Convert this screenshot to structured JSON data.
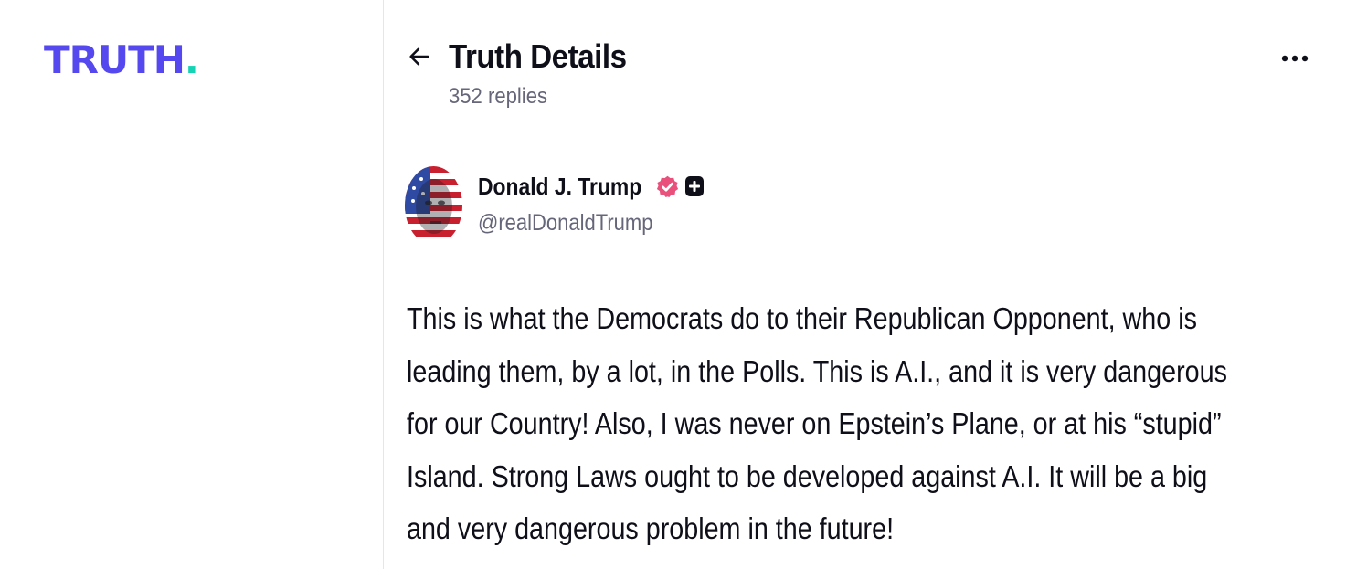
{
  "brand": {
    "logo_text": "TRUTH",
    "logo_dot": ".",
    "primary_color": "#5448ee",
    "accent_color": "#16d3b6"
  },
  "header": {
    "title": "Truth Details",
    "replies": "352 replies",
    "back_icon": "arrow-left-icon",
    "more_icon": "more-horizontal-icon"
  },
  "post": {
    "author": {
      "display_name": "Donald J. Trump",
      "handle": "@realDonaldTrump",
      "verified_icon": "verified-badge-icon",
      "verified_color": "#e9507c",
      "plus_icon": "plus-badge-icon"
    },
    "text": "This is what the Democrats do to their Republican Opponent, who is leading them, by a lot, in the Polls. This is A.I., and it is very dangerous for our Country! Also, I was never on Epstein’s Plane, or at his “stupid” Island. Strong Laws ought to be developed against A.I. It will be a big and very dangerous problem in the future!"
  }
}
